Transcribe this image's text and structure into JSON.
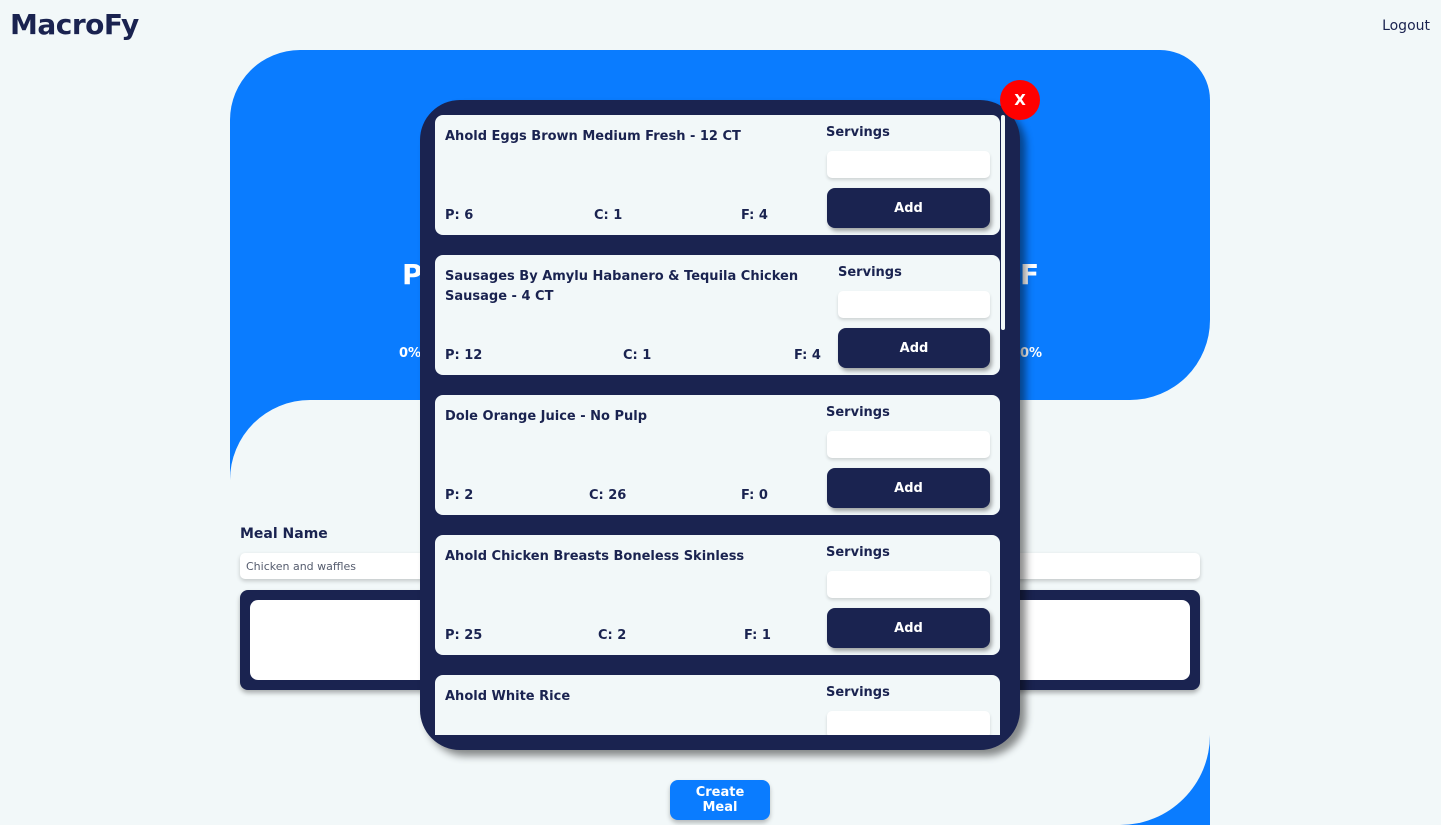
{
  "header": {
    "brand": "MacroFy",
    "logout_label": "Logout"
  },
  "colors": {
    "primary": "#0a7cff",
    "navy": "#1a2350",
    "background": "#f2f8f9",
    "close": "#ff0000"
  },
  "hero": {
    "protein_letter": "P",
    "fat_letter": "F",
    "protein_pct": "0%",
    "fat_pct": "0%"
  },
  "meal": {
    "label": "Meal Name",
    "placeholder": "Chicken and waffles"
  },
  "create_button": "Create Meal",
  "modal": {
    "close_label": "X",
    "servings_label": "Servings",
    "add_label": "Add",
    "foods": [
      {
        "name": "Ahold Eggs Brown Medium Fresh - 12 CT",
        "protein": "P: 6",
        "carbs": "C: 1",
        "fat": "F: 4"
      },
      {
        "name": "Sausages By Amylu Habanero & Tequila Chicken Sausage - 4 CT",
        "protein": "P: 12",
        "carbs": "C: 1",
        "fat": "F: 4"
      },
      {
        "name": "Dole Orange Juice - No Pulp",
        "protein": "P: 2",
        "carbs": "C: 26",
        "fat": "F: 0"
      },
      {
        "name": "Ahold Chicken Breasts Boneless Skinless",
        "protein": "P: 25",
        "carbs": "C: 2",
        "fat": "F: 1"
      },
      {
        "name": "Ahold White Rice",
        "protein": "",
        "carbs": "",
        "fat": ""
      }
    ]
  }
}
